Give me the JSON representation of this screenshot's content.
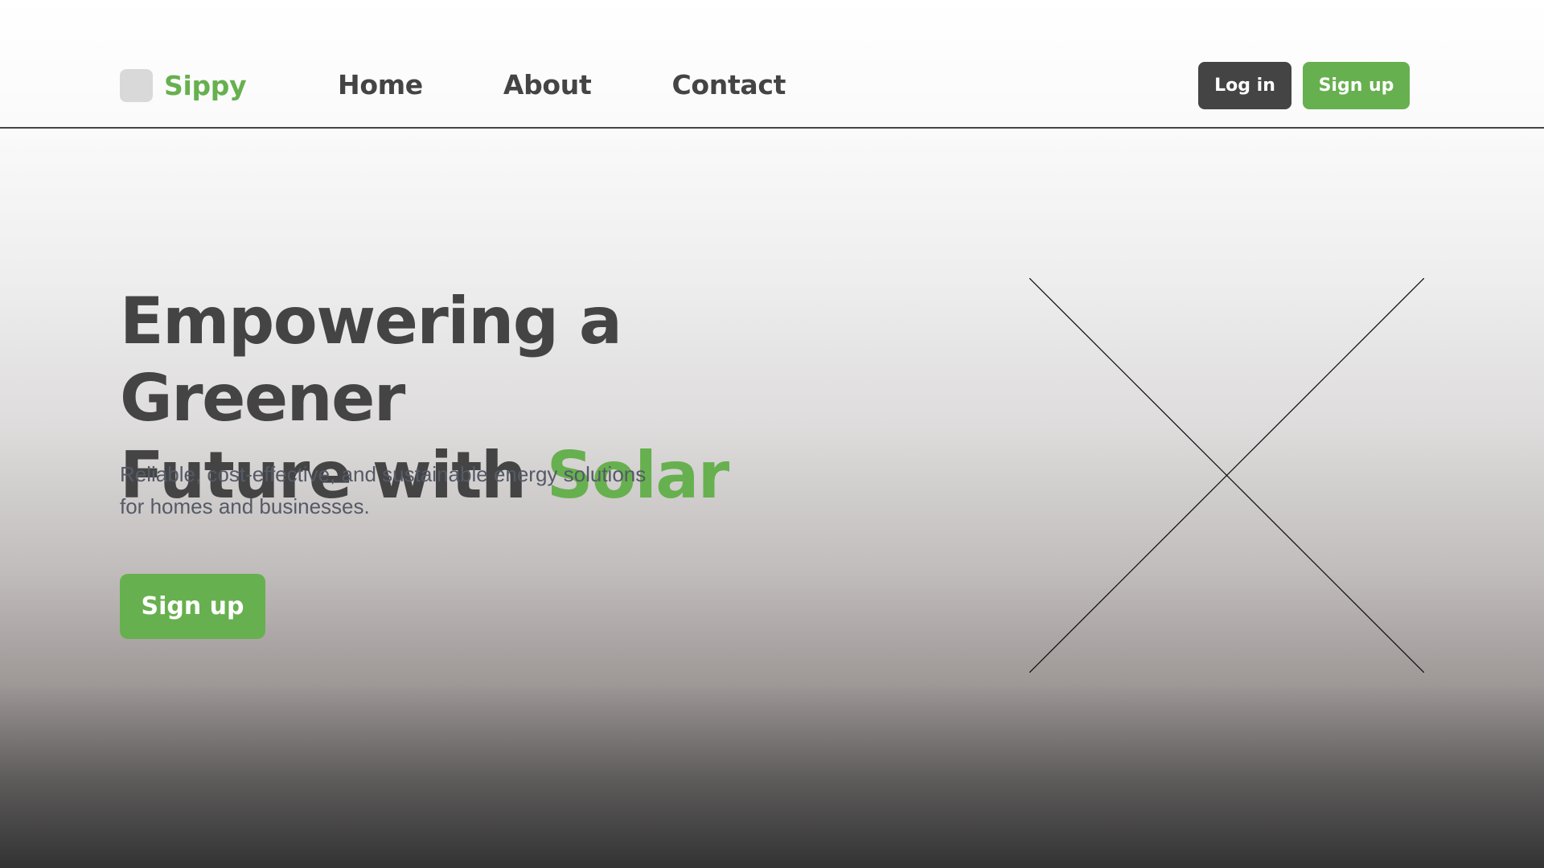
{
  "brand": {
    "name": "Sippy",
    "logo_icon": "logo-square-icon"
  },
  "nav": {
    "items": [
      {
        "label": "Home"
      },
      {
        "label": "About"
      },
      {
        "label": "Contact"
      }
    ]
  },
  "header_actions": {
    "login_label": "Log in",
    "signup_label": "Sign up"
  },
  "hero": {
    "headline_line1": "Empowering a Greener",
    "headline_line2_prefix": "Future with ",
    "headline_accent": "Solar",
    "subtext_line1": "Reliable, cost-effective, and sustainable energy solutions",
    "subtext_line2": "for homes and businesses.",
    "cta_label": "Sign up",
    "image_icon": "image-placeholder-icon"
  },
  "colors": {
    "accent": "#67b04f",
    "dark": "#444444",
    "text_muted": "#555a66"
  }
}
